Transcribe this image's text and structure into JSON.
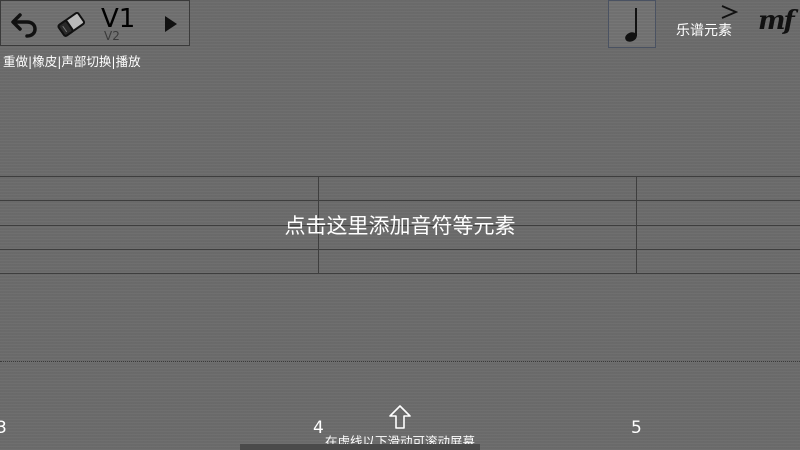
{
  "toolbar": {
    "undo_icon": "undo-arrow-icon",
    "eraser_icon": "eraser-icon",
    "voice_label": "V1",
    "voice_sub_label": "V2",
    "play_icon": "play-icon",
    "hint": "重做|橡皮|声部切换|播放"
  },
  "right_toolbar": {
    "note_icon": "quarter-note-icon",
    "elements_label": "乐谱元素",
    "accent_icon": "accent-mark-icon",
    "dynamics_label": "mf"
  },
  "staff": {
    "prompt": "点击这里添加音符等元素",
    "measure_numbers": [
      "3",
      "4",
      "5"
    ]
  },
  "scroll": {
    "arrow_icon": "arrow-up-outline-icon",
    "hint": "在虚线以下滑动可滚动屏幕"
  },
  "colors": {
    "background": "#6c6c6c",
    "staff_line": "#3e3e3e",
    "text": "#ffffff"
  }
}
